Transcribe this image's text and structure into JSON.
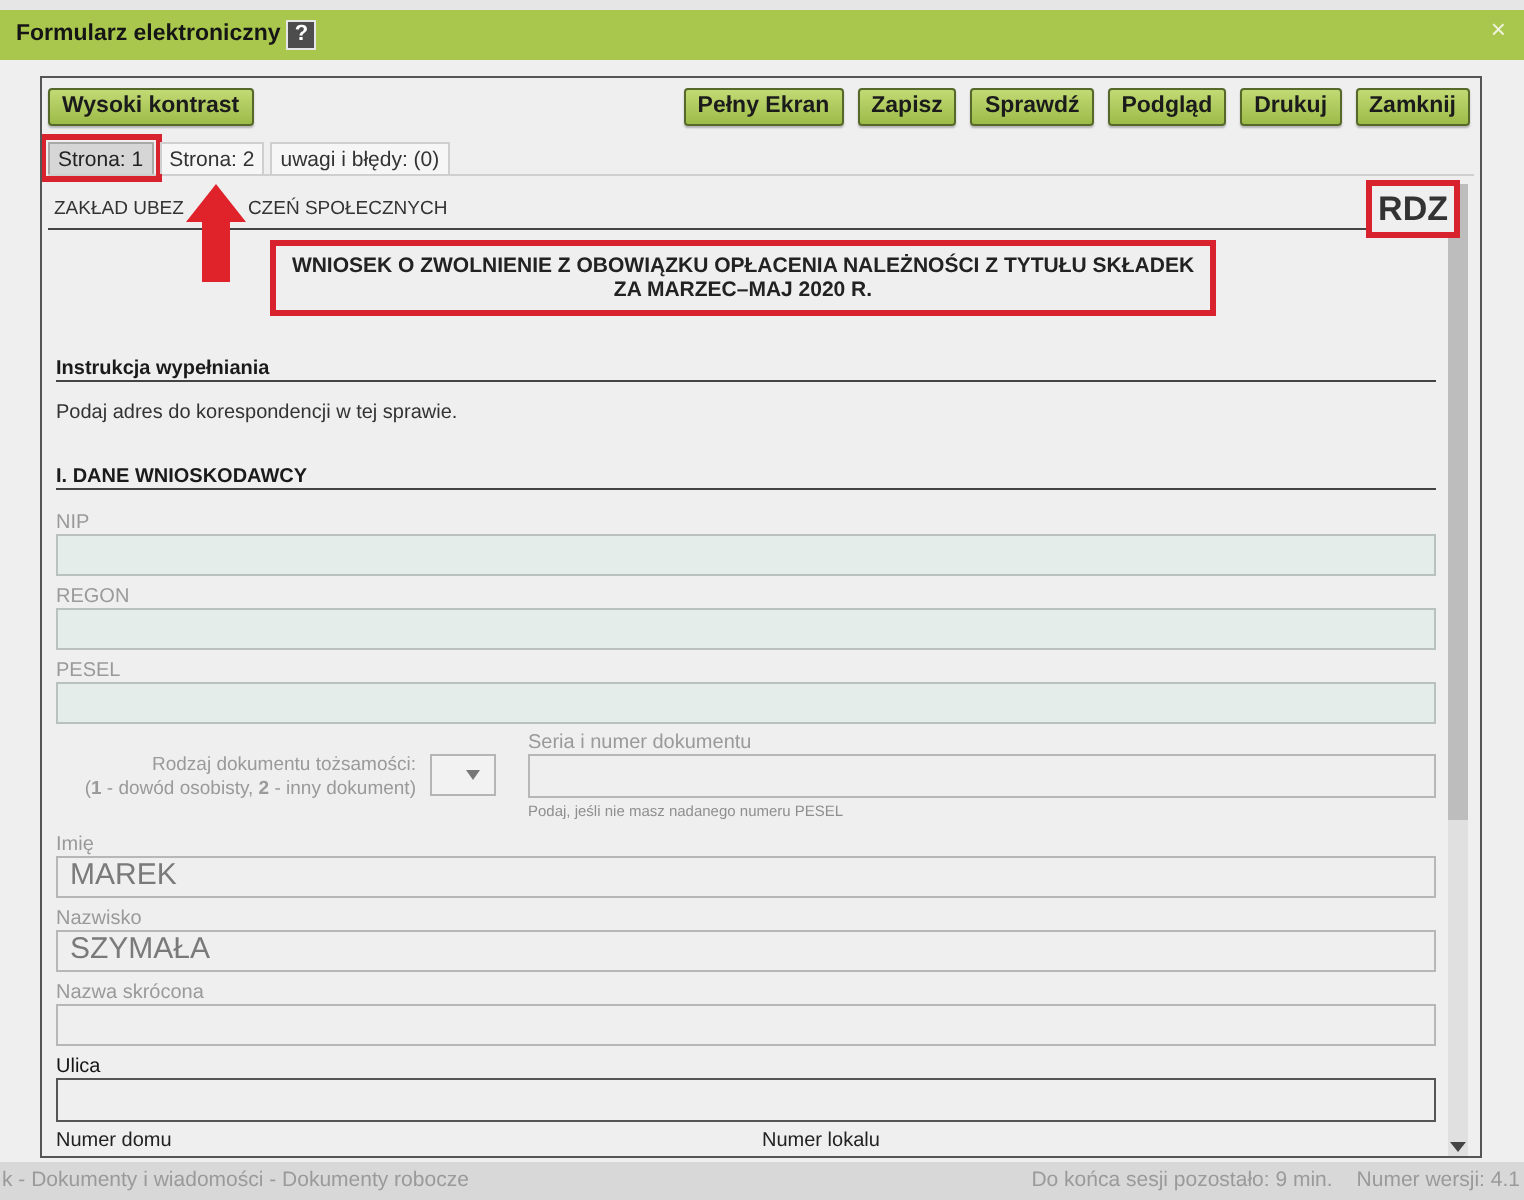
{
  "window": {
    "title": "Formularz elektroniczny",
    "help": "?",
    "close": "×"
  },
  "toolbar": {
    "left": [
      "Wysoki kontrast"
    ],
    "right": [
      "Pełny Ekran",
      "Zapisz",
      "Sprawdź",
      "Podgląd",
      "Drukuj",
      "Zamknij"
    ]
  },
  "tabs": [
    {
      "label": "Strona: 1",
      "selected": true,
      "highlighted": true
    },
    {
      "label": "Strona: 2",
      "selected": false,
      "highlighted": false
    },
    {
      "label": "uwagi i błędy: (0)",
      "selected": false,
      "highlighted": false
    }
  ],
  "header": {
    "issuer_parts": [
      "ZAKŁAD UBEZ",
      "CZEŃ SPOŁECZNYCH"
    ],
    "arrow": true,
    "code": "RDZ",
    "code_highlighted": true
  },
  "form_title": {
    "lines": [
      "WNIOSEK O ZWOLNIENIE Z OBOWIĄZKU OPŁACENIA NALEŻNOŚCI Z TYTUŁU SKŁADEK",
      "ZA MARZEC–MAJ 2020 R."
    ],
    "highlighted": true
  },
  "instructions": {
    "heading": "Instrukcja wypełniania",
    "text": "Podaj adres do korespondencji w tej sprawie."
  },
  "applicant": {
    "heading": "I. DANE WNIOSKODAWCY",
    "fields": [
      {
        "kind": "locked",
        "label": "NIP"
      },
      {
        "kind": "locked",
        "label": "REGON"
      },
      {
        "kind": "locked",
        "label": "PESEL"
      },
      {
        "kind": "document",
        "select_label": "Rodzaj dokumentu tożsamości:\n(**1** - dowód osobisty, **2** - inny dokument)",
        "field_label": "Seria i numer dokumentu",
        "hint": "Podaj, jeśli nie masz nadanego numeru PESEL"
      },
      {
        "kind": "prefilled",
        "label": "Imię",
        "value": "MAREK"
      },
      {
        "kind": "prefilled",
        "label": "Nazwisko",
        "value": "SZYMAŁA"
      },
      {
        "kind": "prefilled",
        "label": "Nazwa skrócona"
      },
      {
        "kind": "editable",
        "label": "Ulica"
      },
      {
        "kind": "pair",
        "labels": [
          "Numer domu",
          "Numer lokalu"
        ]
      }
    ]
  },
  "status_bar": {
    "left": "k - Dokumenty i wiadomości - Dokumenty robocze",
    "session": "Do końca sesji pozostało: 9 min.",
    "version": "Numer wersji: 4.1"
  }
}
